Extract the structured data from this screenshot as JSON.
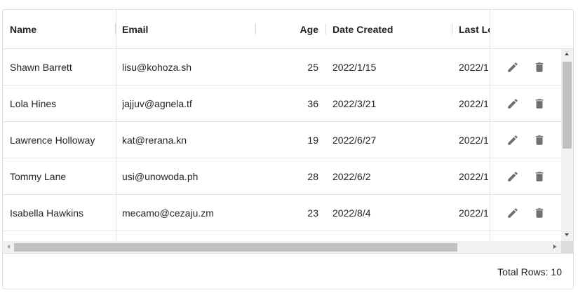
{
  "columns": {
    "name": "Name",
    "email": "Email",
    "age": "Age",
    "date_created": "Date Created",
    "last_login": "Last Login"
  },
  "rows": [
    {
      "name": "Shawn Barrett",
      "email": "lisu@kohoza.sh",
      "age": "25",
      "date_created": "2022/1/15",
      "last_login": "2022/1"
    },
    {
      "name": "Lola Hines",
      "email": "jajjuv@agnela.tf",
      "age": "36",
      "date_created": "2022/3/21",
      "last_login": "2022/1"
    },
    {
      "name": "Lawrence Holloway",
      "email": "kat@rerana.kn",
      "age": "19",
      "date_created": "2022/6/27",
      "last_login": "2022/1"
    },
    {
      "name": "Tommy Lane",
      "email": "usi@unowoda.ph",
      "age": "28",
      "date_created": "2022/6/2",
      "last_login": "2022/1"
    },
    {
      "name": "Isabella Hawkins",
      "email": "mecamo@cezaju.zm",
      "age": "23",
      "date_created": "2022/8/4",
      "last_login": "2022/1"
    }
  ],
  "footer": {
    "total_rows": "Total Rows: 10"
  },
  "icons": {
    "edit": "pencil-icon",
    "delete": "trash-icon"
  },
  "colors": {
    "icon": "#707070",
    "border": "#e0e0e0",
    "scroll_thumb": "#c1c1c1"
  }
}
